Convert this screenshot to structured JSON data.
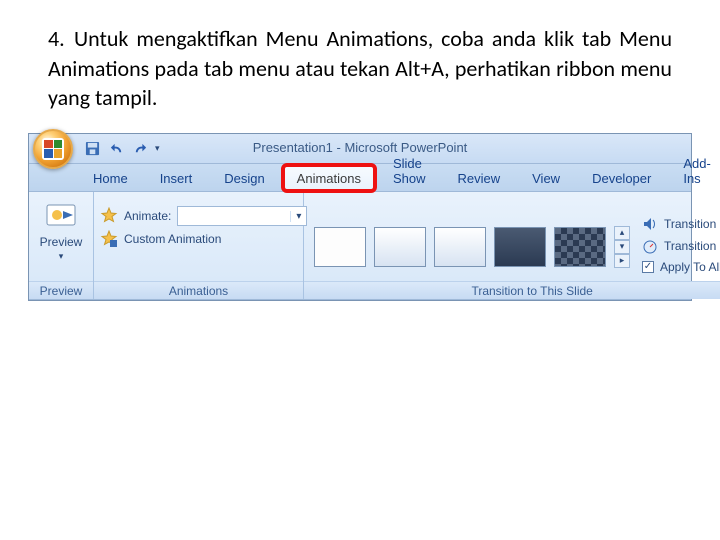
{
  "instruction": {
    "number": "4.",
    "text": "Untuk mengaktifkan Menu Animations, coba anda klik tab Menu Animations pada tab menu atau tekan Alt+A, perhatikan ribbon menu yang tampil."
  },
  "titlebar": {
    "title": "Presentation1 - Microsoft PowerPoint",
    "qat": {
      "save": "save",
      "undo": "undo",
      "redo": "redo"
    }
  },
  "tabs": [
    {
      "id": "home",
      "label": "Home"
    },
    {
      "id": "insert",
      "label": "Insert"
    },
    {
      "id": "design",
      "label": "Design"
    },
    {
      "id": "animations",
      "label": "Animations"
    },
    {
      "id": "slideshow",
      "label": "Slide Show"
    },
    {
      "id": "review",
      "label": "Review"
    },
    {
      "id": "view",
      "label": "View"
    },
    {
      "id": "developer",
      "label": "Developer"
    },
    {
      "id": "addins",
      "label": "Add-Ins"
    }
  ],
  "ribbon": {
    "preview_group": {
      "label": "Preview",
      "button": "Preview"
    },
    "animations_group": {
      "label": "Animations",
      "animate_label": "Animate:",
      "custom_anim": "Custom Animation"
    },
    "transition_group": {
      "label": "Transition to This Slide",
      "sound_label": "Transition Sound",
      "speed_label": "Transition Speed",
      "apply_all": "Apply To All"
    }
  }
}
